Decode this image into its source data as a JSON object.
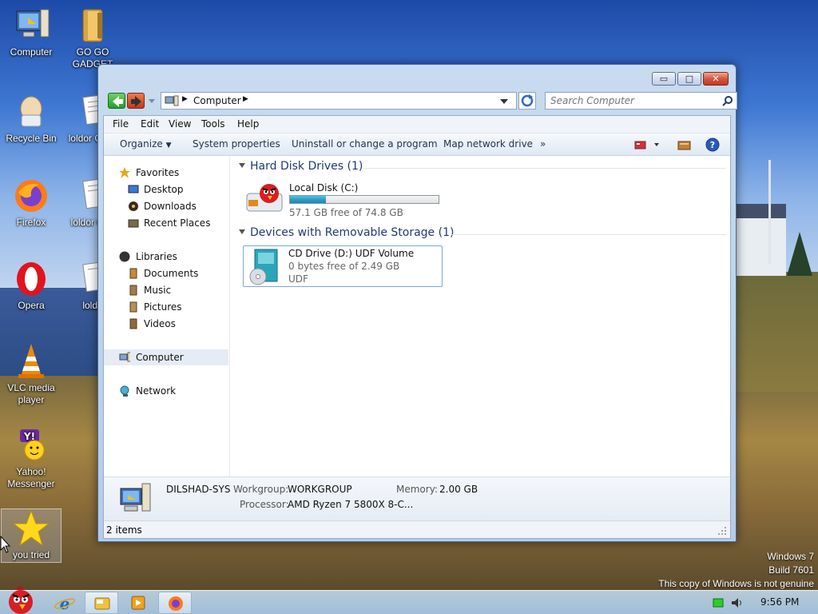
{
  "desktop": {
    "icons": [
      {
        "label": "Computer"
      },
      {
        "label": "GO GO GADGET"
      },
      {
        "label": "Recycle Bin"
      },
      {
        "label": "loldor Copy"
      },
      {
        "label": "Firefox"
      },
      {
        "label": "loldor Cop"
      },
      {
        "label": "Opera"
      },
      {
        "label": "loldo"
      },
      {
        "label": "VLC media player"
      },
      {
        "label": "Yahoo! Messenger"
      },
      {
        "label": "you tried"
      }
    ],
    "watermark": {
      "line1": "Windows 7",
      "line2": "Build 7601",
      "line3": "This copy of Windows is not genuine"
    }
  },
  "window": {
    "caption_buttons": {
      "minimize": "▭",
      "maximize": "□",
      "close": "✕"
    },
    "address": {
      "crumb": "Computer"
    },
    "search": {
      "placeholder": "Search Computer"
    },
    "menu": [
      "File",
      "Edit",
      "View",
      "Tools",
      "Help"
    ],
    "toolbar": {
      "organize": "Organize",
      "system_properties": "System properties",
      "uninstall": "Uninstall or change a program",
      "map_drive": "Map network drive",
      "more": "»"
    },
    "nav": {
      "favorites": "Favorites",
      "desktop": "Desktop",
      "downloads": "Downloads",
      "recent": "Recent Places",
      "libraries": "Libraries",
      "documents": "Documents",
      "music": "Music",
      "pictures": "Pictures",
      "videos": "Videos",
      "computer": "Computer",
      "network": "Network"
    },
    "groups": {
      "hdd": "Hard Disk Drives (1)",
      "removable": "Devices with Removable Storage (1)"
    },
    "drives": {
      "c": {
        "name": "Local Disk (C:)",
        "free": "57.1 GB free of 74.8 GB",
        "used_fraction": 0.24
      },
      "d": {
        "name": "CD Drive (D:) UDF Volume",
        "free": "0 bytes free of 2.49 GB",
        "fs": "UDF"
      }
    },
    "details": {
      "name": "DILSHAD-SYS",
      "workgroup_label": "Workgroup:",
      "workgroup": "WORKGROUP",
      "memory_label": "Memory:",
      "memory": "2.00 GB",
      "processor_label": "Processor:",
      "processor": "AMD Ryzen 7 5800X 8-C..."
    },
    "status": "2 items"
  },
  "taskbar": {
    "clock": "9:56 PM"
  },
  "colors": {
    "accent": "#1e3978",
    "progress": "#2b9bc9"
  }
}
